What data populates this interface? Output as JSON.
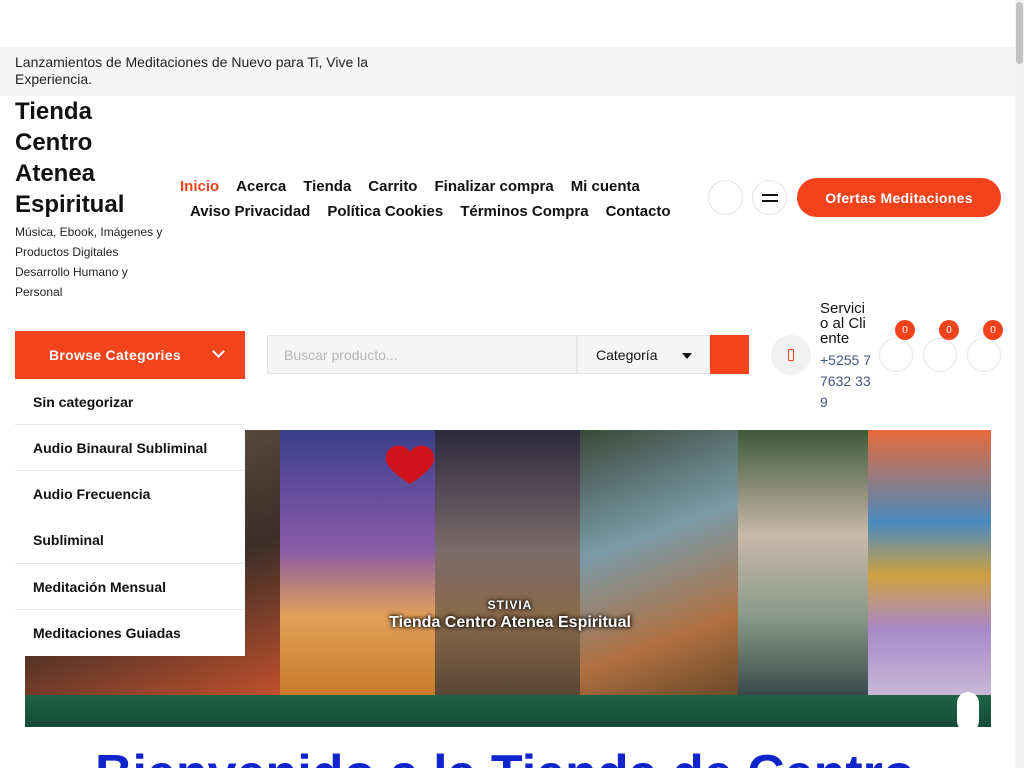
{
  "topbar": {
    "message": "Lanzamientos de Meditaciones de Nuevo para Ti, Vive la Experiencia."
  },
  "brand": {
    "title": "Tienda Centro Atenea Espiritual",
    "tagline": "Música, Ebook, Imágenes y Productos Digitales Desarrollo Humano y Personal"
  },
  "nav": {
    "row1": [
      "Inicio",
      "Acerca",
      "Tienda",
      "Carrito",
      "Finalizar compra",
      "Mi cuenta"
    ],
    "row2": [
      "Aviso Privacidad",
      "Política Cookies",
      "Términos Compra",
      "Contacto"
    ],
    "active": "Inicio"
  },
  "header": {
    "offer_button": "Ofertas Meditaciones"
  },
  "categories": {
    "browse_label": "Browse Categories",
    "items": [
      "Sin categorizar",
      "Audio Binaural Subliminal",
      "Audio Frecuencia Subliminal",
      "Meditación Mensual",
      "Meditaciones Guiadas"
    ]
  },
  "search": {
    "placeholder": "Buscar producto...",
    "category_label": "Categoría"
  },
  "support": {
    "label": "Servicio al Cliente",
    "phone": "+5255 77632 339"
  },
  "counters": {
    "first": "0",
    "second": "0",
    "third": "0"
  },
  "banner": {
    "small_text": "STIVIA",
    "caption": "Tienda Centro Atenea Espiritual"
  },
  "page_heading": "Bienvenido a la Tienda de Centro",
  "colors": {
    "accent": "#f2431c",
    "link": "#1024cc",
    "banner_strip": "#1d5a43"
  }
}
